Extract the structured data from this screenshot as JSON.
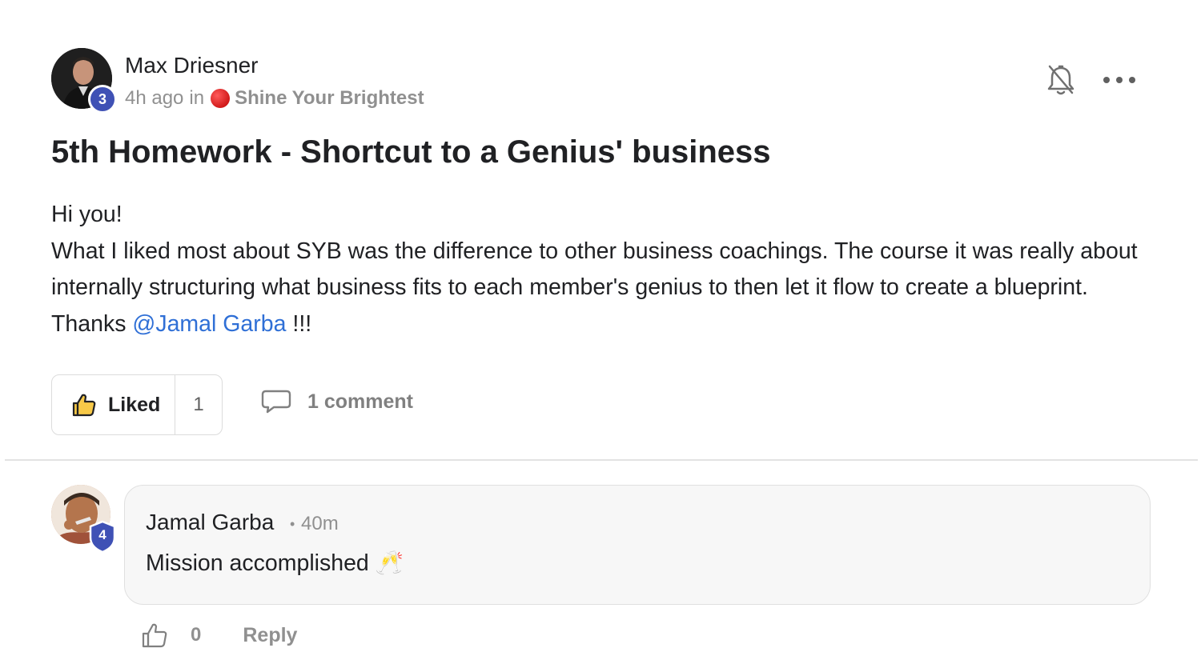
{
  "post": {
    "author": {
      "name": "Max Driesner",
      "level": "3"
    },
    "meta": {
      "time": "4h ago",
      "in_label": "in",
      "group_name": "Shine Your Brightest",
      "group_dot_color": "#e32222"
    },
    "actions": {
      "notifications_icon": "bell-off-icon",
      "more_icon": "more-horizontal-icon"
    },
    "title": "5th Homework - Shortcut to a Genius' business",
    "body": {
      "greeting": "Hi you!",
      "text": "What I liked most about SYB was the difference to other business coachings. The course it was really about internally structuring what business fits to each member's genius to then let it flow to create a blueprint. Thanks ",
      "mention": "@Jamal Garba",
      "text_end": " !!!"
    },
    "reactions": {
      "like_label": "Liked",
      "like_count": "1",
      "comment_label": "1 comment"
    }
  },
  "comment": {
    "author": {
      "name": "Jamal Garba",
      "level": "4"
    },
    "separator": "•",
    "time": "40m",
    "text": "Mission accomplished 🥂",
    "like_count": "0",
    "reply_label": "Reply"
  },
  "colors": {
    "level_badge": "#3f51b5",
    "mention": "#2f6fd6",
    "muted_text": "#909090"
  }
}
